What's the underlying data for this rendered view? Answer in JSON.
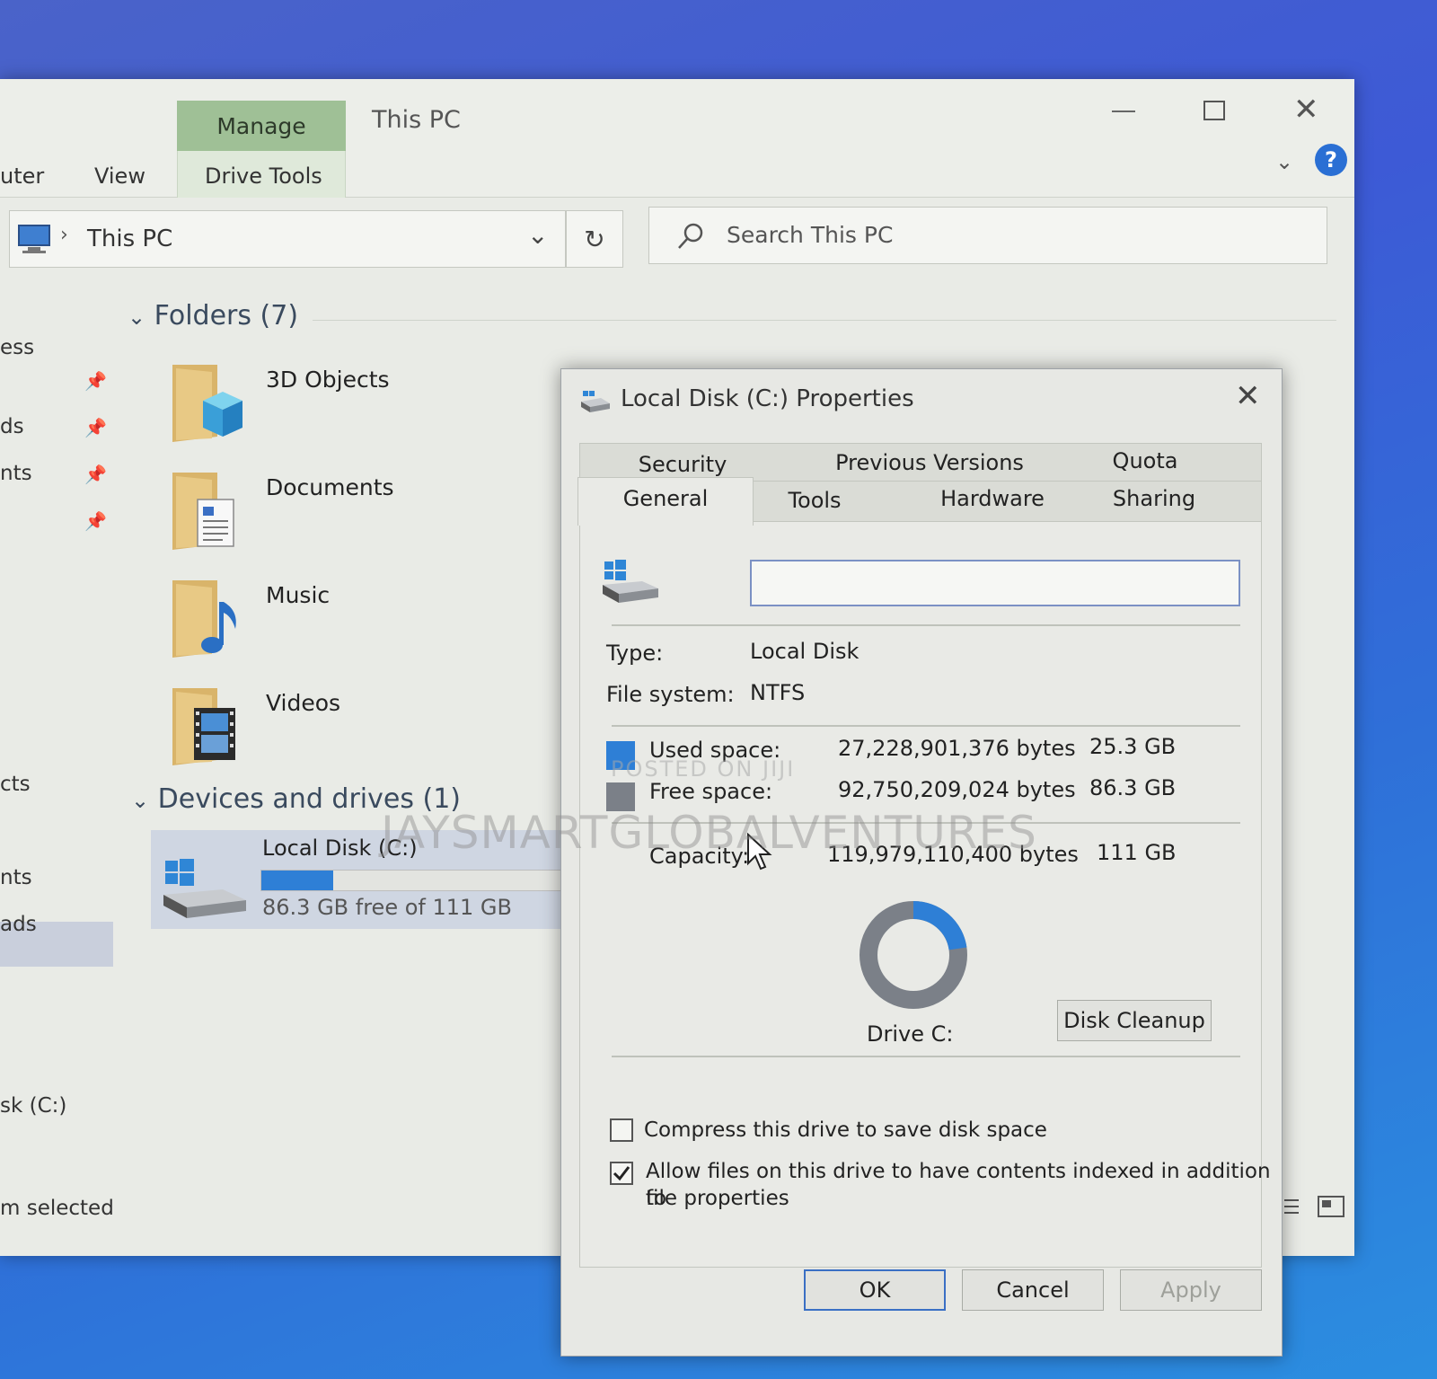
{
  "explorer": {
    "ribbon": {
      "manage_label": "Manage",
      "window_title": "This PC",
      "tabs": [
        "uter",
        "View",
        "Drive Tools"
      ]
    },
    "address": {
      "location": "This PC",
      "search_placeholder": "Search This PC"
    },
    "nav": {
      "items": [
        "ess",
        "ds",
        "nts",
        "cts",
        "nts",
        "ads",
        "sk (C:)"
      ]
    },
    "sections": {
      "folders_header": "Folders (7)",
      "devices_header": "Devices and drives (1)"
    },
    "folders": [
      {
        "label": "3D Objects"
      },
      {
        "label": "Documents"
      },
      {
        "label": "Music"
      },
      {
        "label": "Videos"
      }
    ],
    "drive": {
      "name": "Local Disk (C:)",
      "free_text": "86.3 GB free of 111 GB",
      "used_fraction": 0.23
    },
    "status": {
      "left": "m selected"
    }
  },
  "dialog": {
    "title": "Local Disk (C:) Properties",
    "tabs_row1": [
      "Security",
      "Previous Versions",
      "Quota"
    ],
    "tabs_row2": [
      "General",
      "Tools",
      "Hardware",
      "Sharing"
    ],
    "name_value": "",
    "type_label": "Type:",
    "type_value": "Local Disk",
    "fs_label": "File system:",
    "fs_value": "NTFS",
    "used_label": "Used space:",
    "used_bytes": "27,228,901,376 bytes",
    "used_gb": "25.3 GB",
    "free_label": "Free space:",
    "free_bytes": "92,750,209,024 bytes",
    "free_gb": "86.3 GB",
    "capacity_label": "Capacity:",
    "capacity_bytes": "119,979,110,400 bytes",
    "capacity_gb": "111 GB",
    "drive_label": "Drive C:",
    "disk_cleanup_label": "Disk Cleanup",
    "compress_label": "Compress this drive to save disk space",
    "compress_checked": false,
    "index_label_line1": "Allow files on this drive to have contents indexed in addition to",
    "index_label_line2": "file properties",
    "index_checked": true,
    "used_fraction": 0.227,
    "ok_label": "OK",
    "cancel_label": "Cancel",
    "apply_label": "Apply",
    "colors": {
      "used": "#2e7fd6",
      "free": "#7b8088"
    }
  },
  "watermark": {
    "line1": "POSTED ON JIJI",
    "line2": "JAYSMARTGLOBALVENTURES"
  }
}
